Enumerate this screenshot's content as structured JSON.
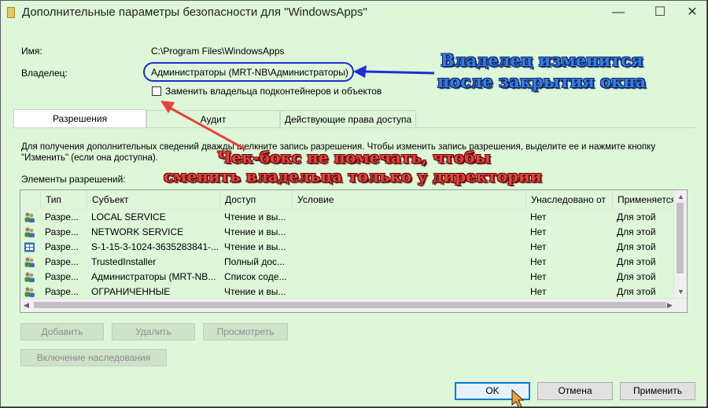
{
  "window": {
    "title": "Дополнительные параметры безопасности  для \"WindowsApps\"",
    "min_glyph": "—",
    "max_glyph": "☐",
    "close_glyph": "✕"
  },
  "name_label": "Имя:",
  "name_value": "C:\\Program Files\\WindowsApps",
  "owner_label": "Владелец:",
  "owner_value": "Администраторы (MRT-NB\\Администраторы)",
  "replace_owner_label": "Заменить владельца подконтейнеров и объектов",
  "replace_owner_checked": false,
  "tabs": [
    {
      "label": "Разрешения",
      "active": true
    },
    {
      "label": "Аудит",
      "active": false
    },
    {
      "label": "Действующие права доступа",
      "active": false
    }
  ],
  "info_line1": "Для получения дополнительных сведений дважды щелкните запись разрешения. Чтобы изменить запись разрешения, выделите ее и нажмите кнопку",
  "info_line2": "\"Изменить\" (если она доступна).",
  "elements_label": "Элементы разрешений:",
  "columns": [
    "Тип",
    "Субъект",
    "Доступ",
    "Условие",
    "Унаследовано от",
    "Применяется"
  ],
  "rows": [
    {
      "icon": "users-icon",
      "type": "Разре...",
      "subject": "LOCAL SERVICE",
      "access": "Чтение и вы...",
      "condition": "",
      "inherited": "Нет",
      "applies": "Для этой пап..."
    },
    {
      "icon": "users-icon",
      "type": "Разре...",
      "subject": "NETWORK SERVICE",
      "access": "Чтение и вы...",
      "condition": "",
      "inherited": "Нет",
      "applies": "Для этой пап..."
    },
    {
      "icon": "package-icon",
      "type": "Разре...",
      "subject": "S-1-15-3-1024-3635283841-...",
      "access": "Чтение и вы...",
      "condition": "",
      "inherited": "Нет",
      "applies": "Для этой пап..."
    },
    {
      "icon": "users-icon",
      "type": "Разре...",
      "subject": "TrustedInstaller",
      "access": "Полный дос...",
      "condition": "",
      "inherited": "Нет",
      "applies": "Для этой пап..."
    },
    {
      "icon": "users-icon",
      "type": "Разре...",
      "subject": "Администраторы (MRT-NB...",
      "access": "Список соде...",
      "condition": "",
      "inherited": "Нет",
      "applies": "Для этой пап..."
    },
    {
      "icon": "users-icon",
      "type": "Разре...",
      "subject": "ОГРАНИЧЕННЫЕ",
      "access": "Чтение и вы...",
      "condition": "",
      "inherited": "Нет",
      "applies": "Для этой пап..."
    }
  ],
  "buttons": {
    "add": "Добавить",
    "remove": "Удалить",
    "view": "Просмотреть",
    "enable_inheritance": "Включение наследования",
    "ok": "OK",
    "cancel": "Отмена",
    "apply": "Применить"
  },
  "annotations": {
    "blue_line1": "Владелец изменится",
    "blue_line2": "после закрытия окна",
    "red_line1": "Чек-бокс не помечать, чтобы",
    "red_line2": "сменить владельца только у директории"
  },
  "colors": {
    "window_bg": "#ddf7d8",
    "annotation_blue": "#2e7fe6",
    "annotation_red": "#e8413b",
    "highlight_ring": "#1c2fd6",
    "default_button_border": "#0078d7"
  }
}
